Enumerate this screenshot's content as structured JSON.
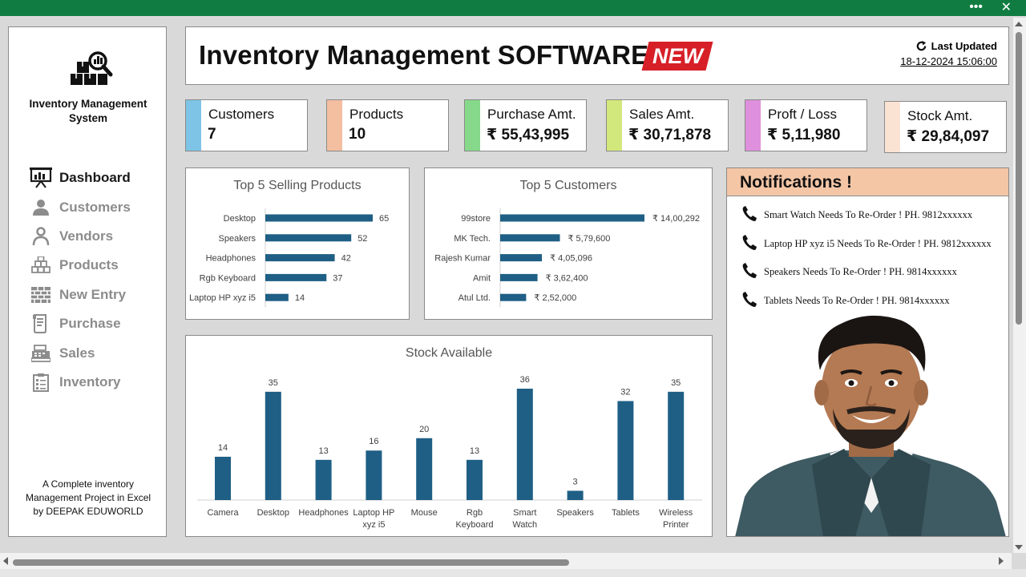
{
  "app": {
    "name_line1": "Inventory Management",
    "name_line2": "System",
    "footer_line1": "A Complete inventory",
    "footer_line2": "Management Project in Excel",
    "footer_line3": "by DEEPAK EDUWORLD"
  },
  "window": {
    "more_icon": "more-dots-icon",
    "close_icon": "close-icon",
    "more_glyph": "•••",
    "close_glyph": "✕"
  },
  "header": {
    "title": "Inventory Management SOFTWARE",
    "badge": "NEW",
    "last_updated_label": "Last Updated",
    "last_updated_value": "18-12-2024  15:06:00",
    "colors": {
      "badge": "#d71f27"
    }
  },
  "sidebar": {
    "items": [
      {
        "label": "Dashboard",
        "icon": "presentation-board-icon",
        "active": true
      },
      {
        "label": "Customers",
        "icon": "user-icon"
      },
      {
        "label": "Vendors",
        "icon": "user-outline-icon"
      },
      {
        "label": "Products",
        "icon": "boxes-icon"
      },
      {
        "label": "New Entry",
        "icon": "brick-wall-icon"
      },
      {
        "label": "Purchase",
        "icon": "receipt-icon"
      },
      {
        "label": "Sales",
        "icon": "cash-register-icon"
      },
      {
        "label": "Inventory",
        "icon": "clipboard-checklist-icon"
      }
    ]
  },
  "kpis": [
    {
      "label": "Customers",
      "value": "7",
      "color": "#7ec4e6"
    },
    {
      "label": "Products",
      "value": "10",
      "color": "#f4bfa0"
    },
    {
      "label": "Purchase Amt.",
      "value": "₹ 55,43,995",
      "color": "#86d98a"
    },
    {
      "label": "Sales Amt.",
      "value": "₹ 30,71,878",
      "color": "#d3e87c"
    },
    {
      "label": "Proft / Loss",
      "value": "₹ 5,11,980",
      "color": "#de90dc"
    },
    {
      "label": "Stock Amt.",
      "value": "₹ 29,84,097",
      "color": "#fbe3d4"
    }
  ],
  "chart_data": [
    {
      "type": "bar",
      "orientation": "horizontal",
      "title": "Top 5 Selling Products",
      "categories": [
        "Desktop",
        "Speakers",
        "Headphones",
        "Rgb Keyboard",
        "Laptop HP xyz i5"
      ],
      "values": [
        65,
        52,
        42,
        37,
        14
      ],
      "labels": [
        "65",
        "52",
        "42",
        "37",
        "14"
      ],
      "color": "#1f5f85",
      "xlim": [
        0,
        65
      ]
    },
    {
      "type": "bar",
      "orientation": "horizontal",
      "title": "Top 5 Customers",
      "categories": [
        "99store",
        "MK Tech.",
        "Rajesh Kumar",
        "Amit",
        "Atul Ltd."
      ],
      "values": [
        1400292,
        579600,
        405096,
        362400,
        252000
      ],
      "labels": [
        "₹ 14,00,292",
        "₹ 5,79,600",
        "₹ 4,05,096",
        "₹ 3,62,400",
        "₹ 2,52,000"
      ],
      "color": "#1f5f85",
      "xlim": [
        0,
        1400292
      ]
    },
    {
      "type": "bar",
      "orientation": "vertical",
      "title": "Stock Available",
      "categories": [
        [
          "Camera"
        ],
        [
          "Desktop"
        ],
        [
          "Headphones"
        ],
        [
          "Laptop HP",
          "xyz i5"
        ],
        [
          "Mouse"
        ],
        [
          "Rgb",
          "Keyboard"
        ],
        [
          "Smart",
          "Watch"
        ],
        [
          "Speakers"
        ],
        [
          "Tablets"
        ],
        [
          "Wireless",
          "Printer"
        ]
      ],
      "values": [
        14,
        35,
        13,
        16,
        20,
        13,
        36,
        3,
        32,
        35
      ],
      "labels": [
        "14",
        "35",
        "13",
        "16",
        "20",
        "13",
        "36",
        "3",
        "32",
        "35"
      ],
      "color": "#1f5f85",
      "ylim": [
        0,
        36
      ]
    }
  ],
  "notifications": {
    "title": "Notifications !",
    "icon": "phone-icon",
    "items": [
      "Smart Watch Needs To Re-Order ! PH. 9812xxxxxx",
      "Laptop HP xyz i5 Needs To Re-Order ! PH. 9812xxxxxx",
      "Speakers Needs To Re-Order ! PH. 9814xxxxxx",
      "Tablets Needs To Re-Order ! PH. 9814xxxxxx"
    ]
  }
}
